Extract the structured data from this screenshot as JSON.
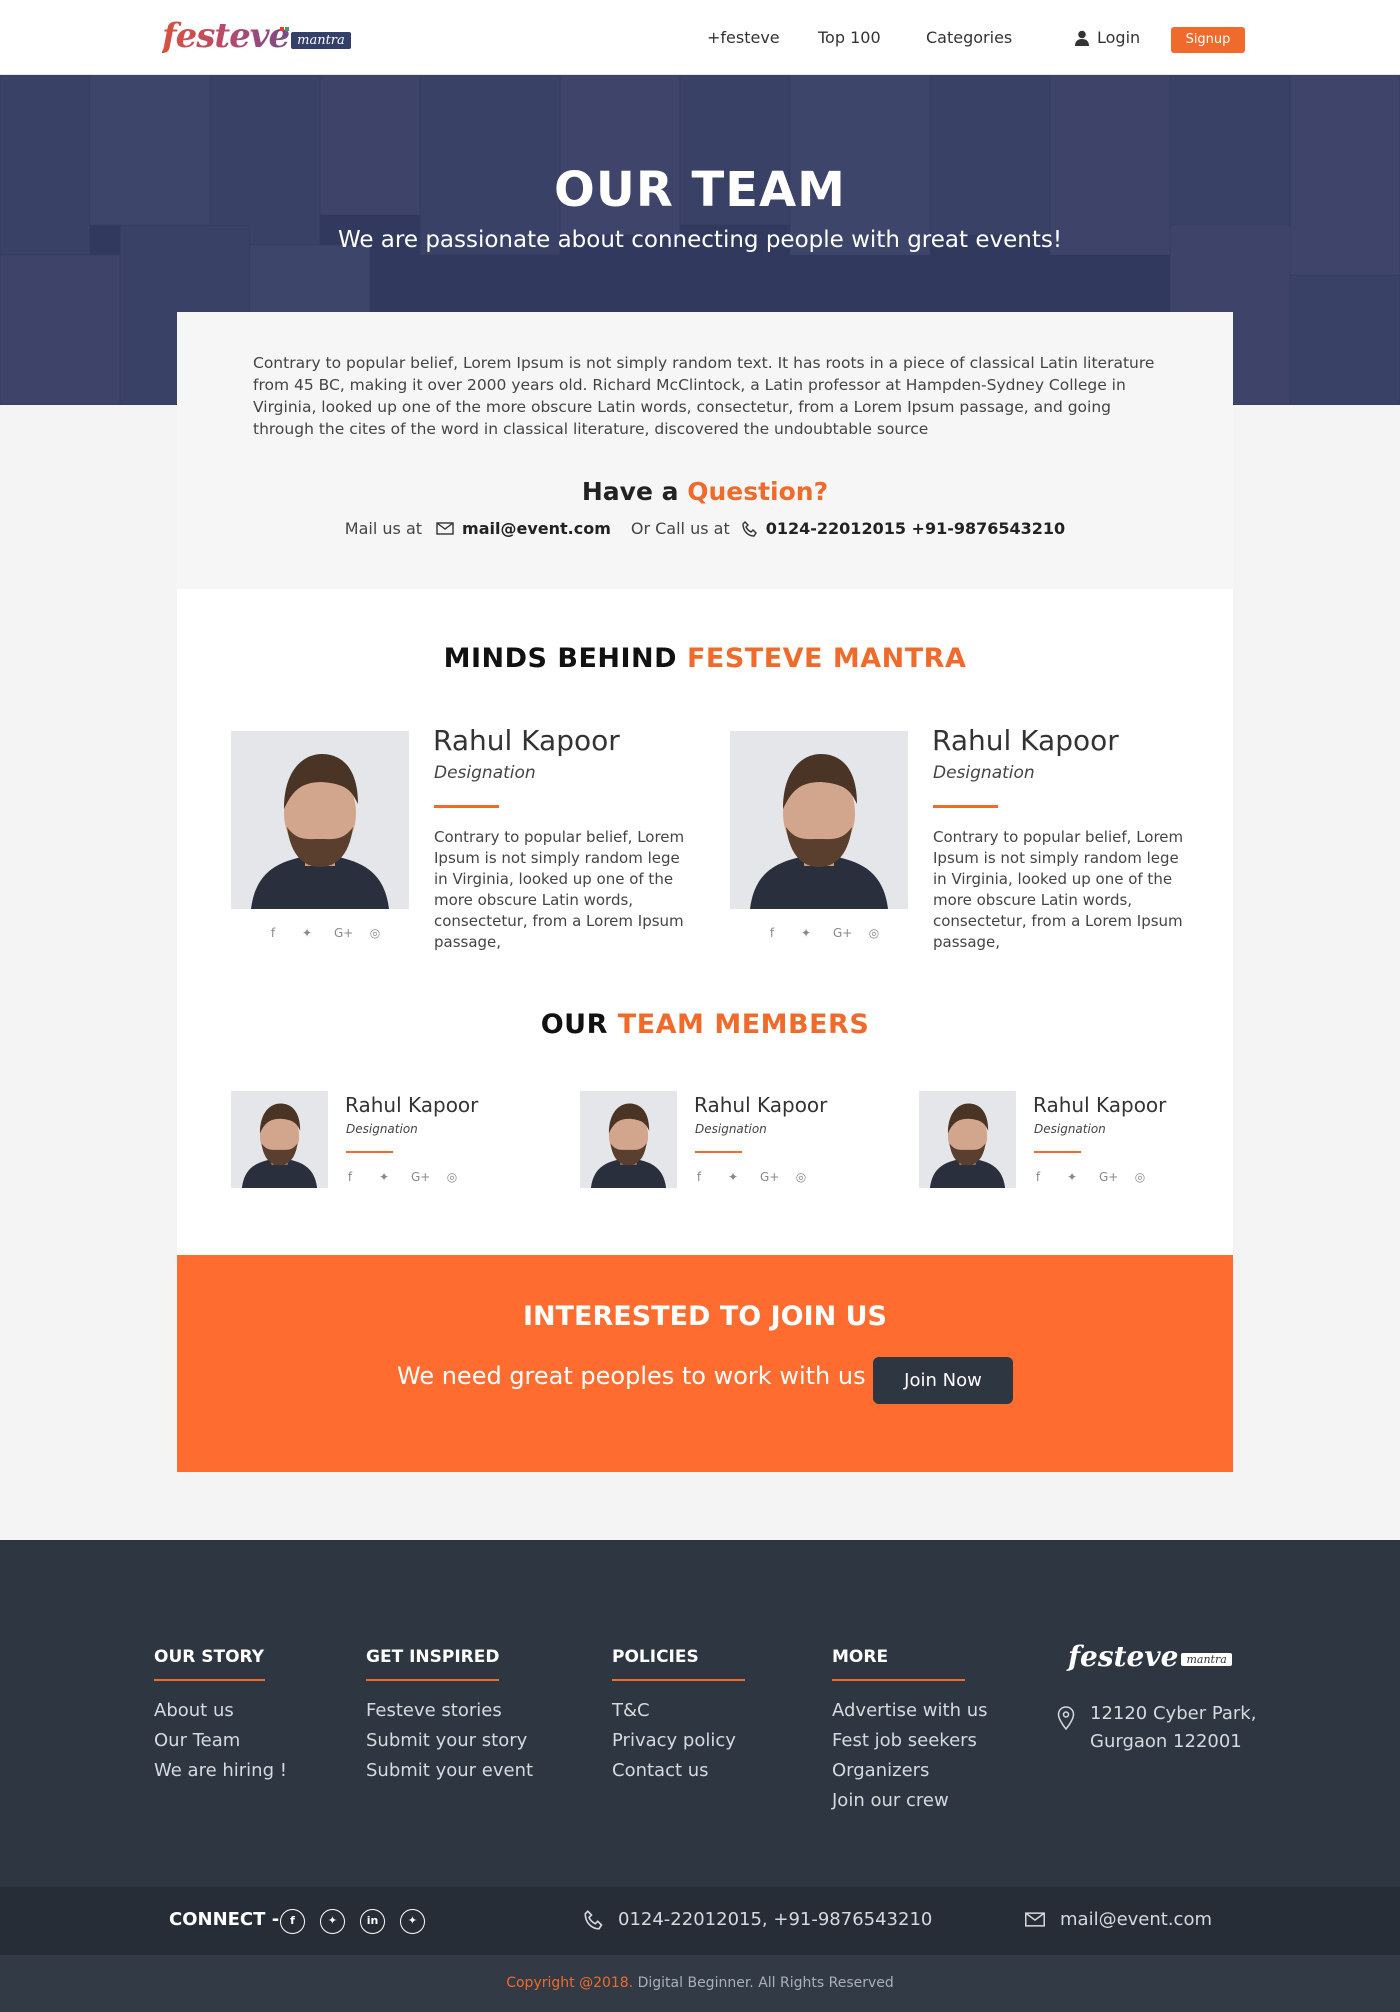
{
  "header": {
    "logo_text": "festeve",
    "logo_badge": "mantra",
    "nav": [
      "+festeve",
      "Top 100",
      "Categories"
    ],
    "login": "Login",
    "signup": "Signup"
  },
  "hero": {
    "title": "OUR TEAM",
    "subtitle": "We are passionate about connecting people with great events!"
  },
  "intro": {
    "text": "Contrary to popular belief, Lorem Ipsum is not simply random text. It has roots in a piece of classical Latin literature from 45 BC, making it over 2000 years old. Richard McClintock, a Latin professor at Hampden-Sydney College in Virginia, looked up one of the more obscure Latin words, consectetur, from a Lorem Ipsum passage, and going through the cites of the word in classical literature, discovered the undoubtable source",
    "question_prefix": "Have a",
    "question_highlight": "Question?",
    "mail_label": "Mail us at",
    "mail": "mail@event.com",
    "call_label": "Or Call us at",
    "phone": "0124-22012015 +91-9876543210"
  },
  "leaders": {
    "title_prefix": "MINDS BEHIND",
    "title_highlight": "FESTEVE MANTRA",
    "people": [
      {
        "name": "Rahul Kapoor",
        "designation": "Designation",
        "bio": "Contrary to popular belief, Lorem Ipsum is not simply random lege in Virginia, looked up one of the more obscure Latin words, consectetur, from a Lorem Ipsum passage,"
      },
      {
        "name": "Rahul Kapoor",
        "designation": "Designation",
        "bio": "Contrary to popular belief, Lorem Ipsum is not simply random lege in Virginia, looked up one of the more obscure Latin words, consectetur, from a Lorem Ipsum passage,"
      }
    ]
  },
  "members": {
    "title_prefix": "OUR",
    "title_highlight": "TEAM MEMBERS",
    "people": [
      {
        "name": "Rahul Kapoor",
        "designation": "Designation"
      },
      {
        "name": "Rahul Kapoor",
        "designation": "Designation"
      },
      {
        "name": "Rahul Kapoor",
        "designation": "Designation"
      }
    ]
  },
  "social_icons": [
    "facebook-icon",
    "twitter-icon",
    "google-plus-icon",
    "instagram-icon"
  ],
  "join": {
    "title": "INTERESTED TO JOIN US",
    "text": "We need great peoples to work with us",
    "button": "Join Now"
  },
  "footer": {
    "columns": [
      {
        "heading": "OUR STORY",
        "links": [
          "About us",
          "Our Team",
          "We are hiring !"
        ]
      },
      {
        "heading": "GET INSPIRED",
        "links": [
          "Festeve stories",
          "Submit your story",
          "Submit your event"
        ]
      },
      {
        "heading": "POLICIES",
        "links": [
          "T&C",
          "Privacy policy",
          "Contact us"
        ]
      },
      {
        "heading": "MORE",
        "links": [
          "Advertise with us",
          "Fest job seekers",
          "Organizers",
          "Join our crew"
        ]
      }
    ],
    "address_line1": "12120 Cyber Park,",
    "address_line2": "Gurgaon 122001",
    "connect_label": "CONNECT -",
    "phone": "0124-22012015, +91-9876543210",
    "mail": "mail@event.com",
    "copyright_highlight": "Copyright @2018.",
    "copyright_rest": "Digital Beginner. All Rights Reserved"
  },
  "colors": {
    "accent": "#f06b2b",
    "join_bg": "#ff6c2f",
    "footer_bg": "#2e3641",
    "hero_overlay": "#3b4366"
  }
}
